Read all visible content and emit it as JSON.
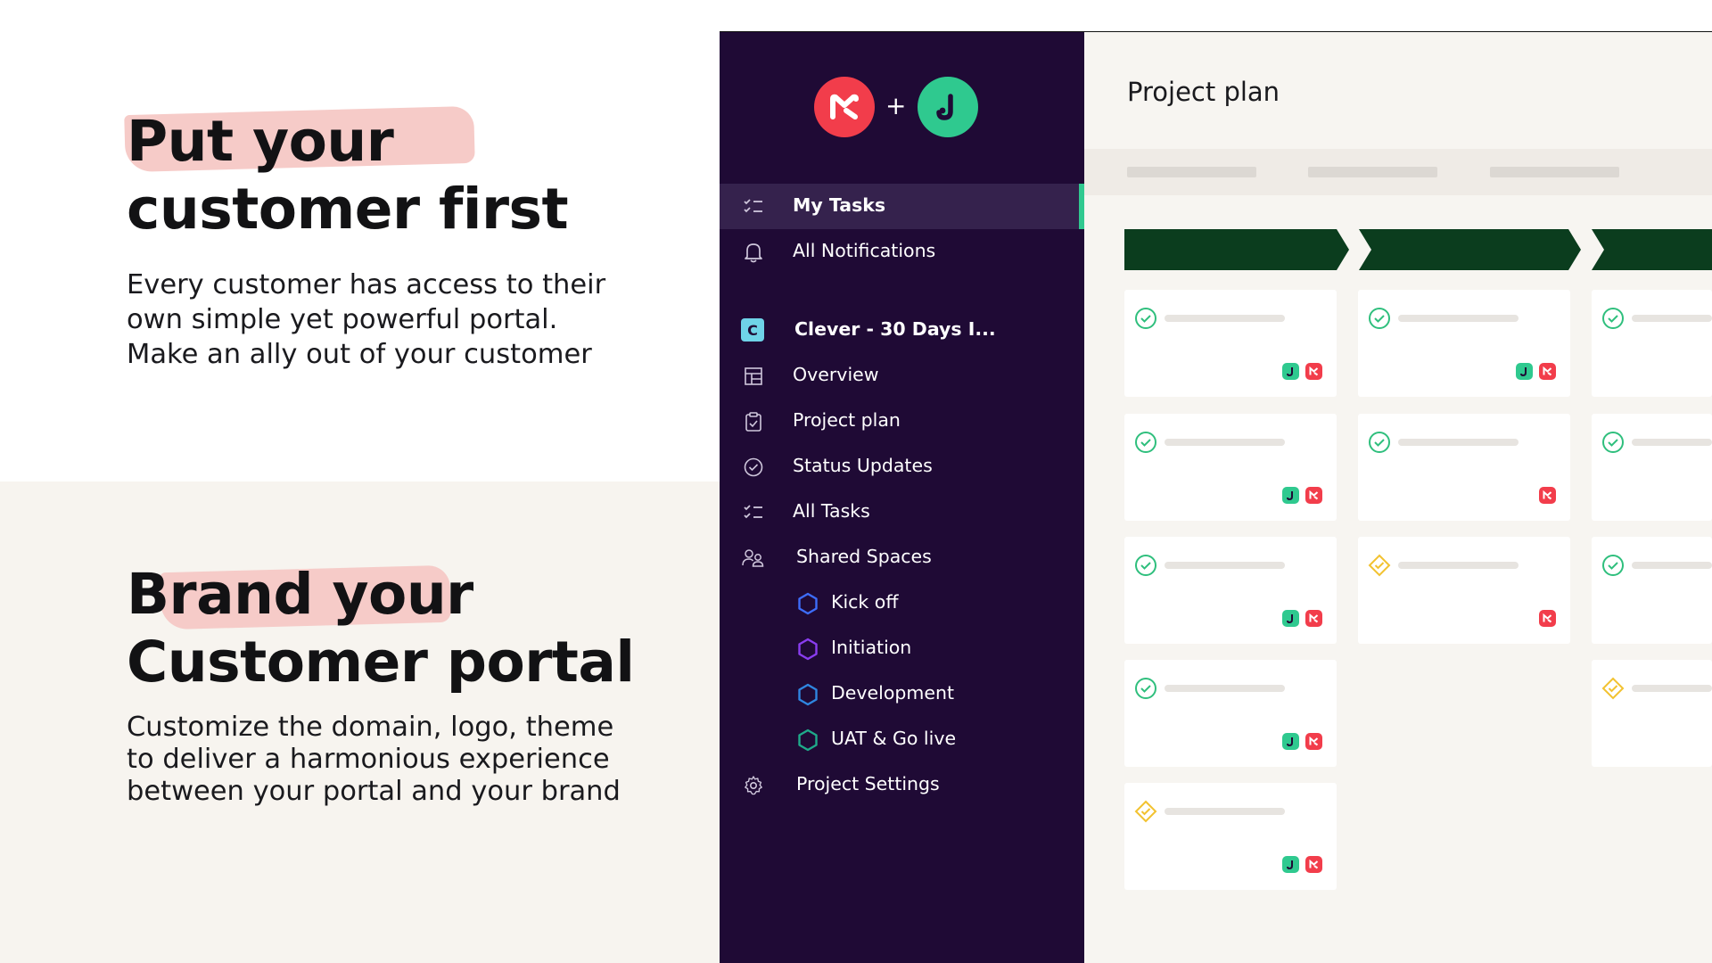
{
  "marketing": {
    "section1": {
      "headline_line1": "Put your",
      "headline_line2": "customer first",
      "body_line1": "Every customer has access to their",
      "body_line2": "own simple yet powerful portal.",
      "body_line3": "Make an ally out of your customer"
    },
    "section2": {
      "headline_line1": "Brand your",
      "headline_line2": "Customer portal",
      "body_line1": "Customize the domain, logo, theme",
      "body_line2": "to deliver a harmonious experience",
      "body_line3": "between your portal and your brand"
    }
  },
  "sidebar": {
    "logo_plus": "+",
    "nav": [
      {
        "label": "My Tasks",
        "icon": "checklist-icon",
        "active": true
      },
      {
        "label": "All Notifications",
        "icon": "bell-icon",
        "active": false
      }
    ],
    "project": {
      "badge": "C",
      "name": "Clever - 30 Days I..."
    },
    "project_nav": [
      {
        "label": "Overview",
        "icon": "dashboard-icon"
      },
      {
        "label": "Project plan",
        "icon": "clipboard-icon"
      },
      {
        "label": "Status Updates",
        "icon": "check-circle-icon"
      },
      {
        "label": "All Tasks",
        "icon": "checklist-icon"
      },
      {
        "label": "Shared Spaces",
        "icon": "people-icon"
      }
    ],
    "spaces": [
      {
        "label": "Kick off",
        "icon": "hexagon-icon",
        "color": "#3d6dfa"
      },
      {
        "label": "Initiation",
        "icon": "hexagon-icon",
        "color": "#8a3df0"
      },
      {
        "label": "Development",
        "icon": "hexagon-icon",
        "color": "#2f86e0"
      },
      {
        "label": "UAT & Go live",
        "icon": "hexagon-icon",
        "color": "#1faa8a"
      }
    ],
    "settings": {
      "label": "Project Settings",
      "icon": "gear-icon"
    }
  },
  "content": {
    "title": "Project plan"
  },
  "colors": {
    "sidebar_bg": "#1f0a35",
    "accent_green": "#30c990",
    "phase_green": "#0b3d1e",
    "brand_red": "#f23d4b",
    "status_done": "#2fbf7d",
    "status_pending": "#f2c230"
  }
}
